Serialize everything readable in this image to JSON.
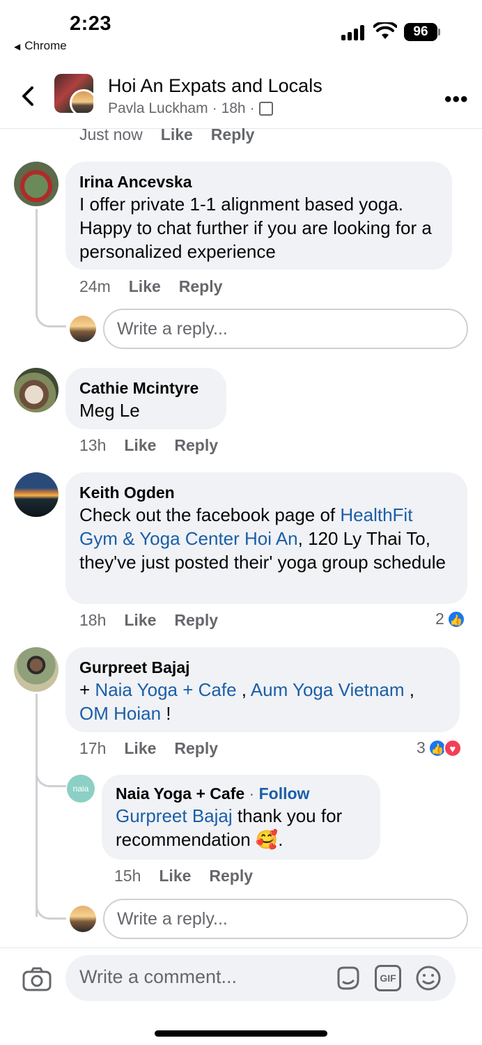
{
  "status_bar": {
    "time": "2:23",
    "back_app": "Chrome",
    "battery": "96"
  },
  "header": {
    "title": "Hoi An Expats and Locals",
    "poster": "Pavla Luckham",
    "age": "18h",
    "separator": "·"
  },
  "top_meta": {
    "time": "Just now",
    "like": "Like",
    "reply": "Reply"
  },
  "comments": [
    {
      "author": "Irina Ancevska",
      "text": "I offer private 1-1 alignment based yoga. Happy to chat further if you are looking for a personalized experience",
      "time": "24m",
      "like": "Like",
      "reply": "Reply",
      "reply_placeholder": "Write a reply..."
    },
    {
      "author": "Cathie Mcintyre",
      "text": "Meg Le",
      "time": "13h",
      "like": "Like",
      "reply": "Reply"
    },
    {
      "author": "Keith Ogden",
      "text_before": "Check out the facebook page of ",
      "link": "HealthFit Gym & Yoga Center Hoi An",
      "text_after": ", 120 Ly Thai To, they've just posted their' yoga group schedule",
      "time": "18h",
      "like": "Like",
      "reply": "Reply",
      "reaction_count": "2"
    },
    {
      "author": "Gurpreet Bajaj",
      "prefix": "+ ",
      "link1": "Naia Yoga + Cafe",
      "sep1": " , ",
      "link2": "Aum Yoga Vietnam",
      "sep2": " ,",
      "link3": "OM Hoian",
      "suffix": " !",
      "time": "17h",
      "like": "Like",
      "reply": "Reply",
      "reaction_count": "3",
      "reply_item": {
        "author": "Naia Yoga + Cafe",
        "dot": " · ",
        "follow": "Follow",
        "mention": "Gurpreet Bajaj",
        "text": " thank you for recommendation 🥰.",
        "avatar_text": "naia",
        "time": "15h",
        "like": "Like",
        "reply": "Reply"
      },
      "reply_placeholder": "Write a reply..."
    }
  ],
  "composer": {
    "placeholder": "Write a comment...",
    "gif": "GIF"
  },
  "colors": {
    "link": "#1b5ea8",
    "accent": "#1877f2",
    "love": "#f33e58",
    "bubble": "#f0f2f5"
  },
  "icons": [
    "back-chevron-icon",
    "more-icon",
    "camera-icon",
    "sticker-icon",
    "gif-icon",
    "emoji-icon",
    "like-reaction-icon",
    "love-reaction-icon"
  ]
}
